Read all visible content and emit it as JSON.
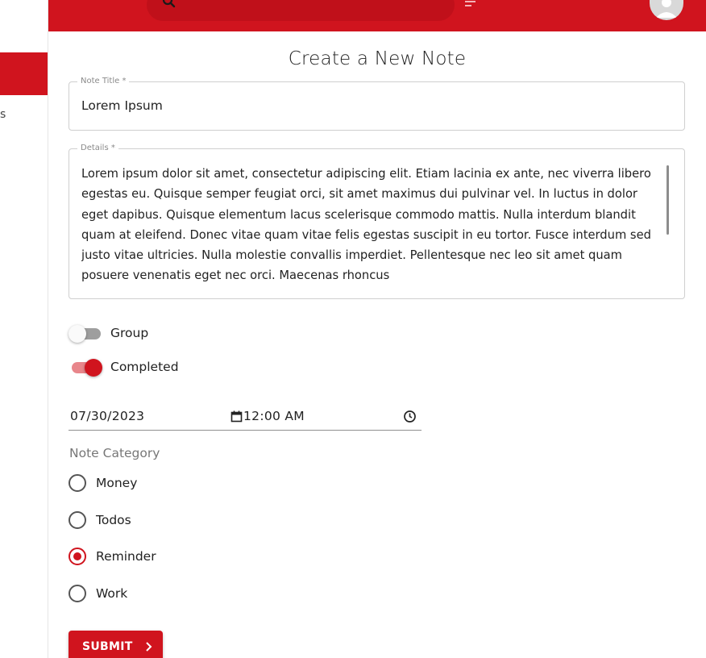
{
  "appbar": {
    "color": "#d0141e"
  },
  "drawer": {
    "partial_item_text": "s"
  },
  "page": {
    "title": "Create a New Note"
  },
  "form": {
    "title_field": {
      "label": "Note Title *",
      "value": "Lorem Ipsum"
    },
    "details_field": {
      "label": "Details *",
      "value": "Lorem ipsum dolor sit amet, consectetur adipiscing elit. Etiam lacinia ex ante, nec viverra libero egestas eu. Quisque semper feugiat orci, sit amet maximus dui pulvinar vel. In luctus in dolor eget dapibus. Quisque elementum lacus scelerisque commodo mattis. Nulla interdum blandit quam at eleifend. Donec vitae quam vitae felis egestas suscipit in eu tortor. Fusce interdum sed justo vitae ultricies. Nulla molestie convallis imperdiet. Pellentesque nec leo sit amet quam posuere venenatis eget nec orci. Maecenas rhoncus"
    },
    "switches": [
      {
        "label": "Group",
        "checked": false
      },
      {
        "label": "Completed",
        "checked": true
      }
    ],
    "date": "07/30/2023",
    "time": "12:00 AM",
    "category": {
      "legend": "Note Category",
      "options": [
        {
          "label": "Money",
          "checked": false
        },
        {
          "label": "Todos",
          "checked": false
        },
        {
          "label": "Reminder",
          "checked": true
        },
        {
          "label": "Work",
          "checked": false
        }
      ]
    },
    "submit_label": "SUBMIT"
  }
}
